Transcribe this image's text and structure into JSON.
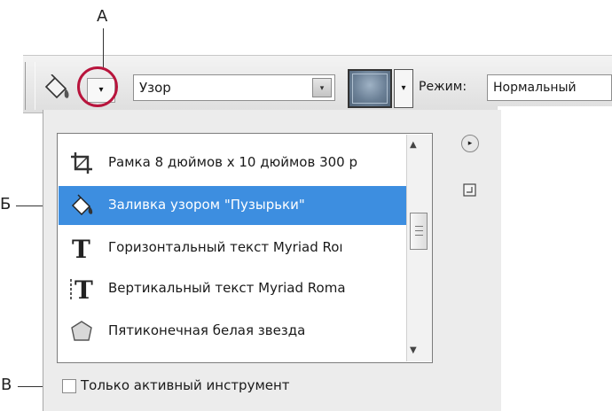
{
  "callouts": {
    "a": "А",
    "b": "Б",
    "v": "В"
  },
  "options_bar": {
    "tool_icon": "paint-bucket-icon",
    "preset_arrow_glyph": "▾",
    "fill_source": "Узор",
    "fill_dropdown_glyph": "▾",
    "pattern_arrow_glyph": "▾",
    "mode_label": "Режим:",
    "mode_value": "Нормальный"
  },
  "preset_picker": {
    "items": [
      {
        "icon": "crop-icon",
        "label": "Рамка 8 дюймов x 10 дюймов 300 р"
      },
      {
        "icon": "paint-bucket-icon",
        "label": "Заливка узором \"Пузырьки\"",
        "selected": true
      },
      {
        "icon": "horizontal-type-icon",
        "label": "Горизонтальный текст Myriad Roı"
      },
      {
        "icon": "vertical-type-icon",
        "label": "Вертикальный текст Myriad Roma"
      },
      {
        "icon": "polygon-icon",
        "label": "Пятиконечная белая звезда"
      }
    ],
    "menu_glyph": "▸",
    "scroll_up_glyph": "▲",
    "scroll_down_glyph": "▼",
    "current_tool_only_label": "Только активный инструмент",
    "current_tool_only_checked": false
  },
  "colors": {
    "selection": "#3d8ee0",
    "callout_circle": "#b8143c"
  }
}
